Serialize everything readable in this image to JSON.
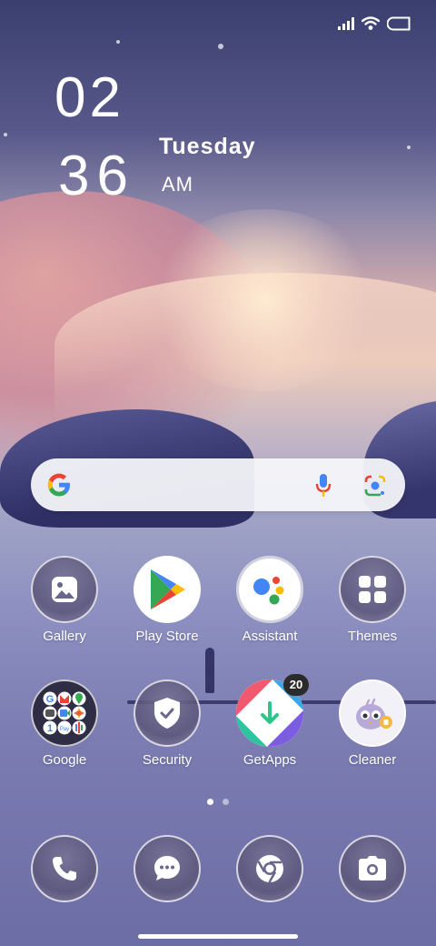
{
  "status_bar": {
    "icons": [
      "signal-icon",
      "wifi-icon",
      "battery-icon"
    ]
  },
  "clock": {
    "hour": "02",
    "minute": "36",
    "day": "Tuesday",
    "ampm": "AM"
  },
  "search_bar": {
    "icons": [
      "google-g-icon",
      "microphone-icon",
      "google-lens-icon"
    ]
  },
  "apps_row1": [
    {
      "label": "Gallery",
      "icon": "gallery-icon"
    },
    {
      "label": "Play Store",
      "icon": "play-store-icon"
    },
    {
      "label": "Assistant",
      "icon": "assistant-icon"
    },
    {
      "label": "Themes",
      "icon": "themes-icon"
    }
  ],
  "apps_row2": [
    {
      "label": "Google",
      "icon": "google-folder-icon"
    },
    {
      "label": "Security",
      "icon": "security-shield-icon"
    },
    {
      "label": "GetApps",
      "icon": "getapps-icon",
      "badge": "20"
    },
    {
      "label": "Cleaner",
      "icon": "cleaner-icon"
    }
  ],
  "page_indicator": {
    "pages": 2,
    "current": 1
  },
  "dock": [
    {
      "icon": "phone-icon"
    },
    {
      "icon": "messages-icon"
    },
    {
      "icon": "chrome-icon"
    },
    {
      "icon": "camera-icon"
    }
  ],
  "colors": {
    "assistant_blue": "#4285F4",
    "assistant_red": "#EA4335",
    "assistant_yellow": "#FBBC05",
    "assistant_green": "#34A853"
  }
}
